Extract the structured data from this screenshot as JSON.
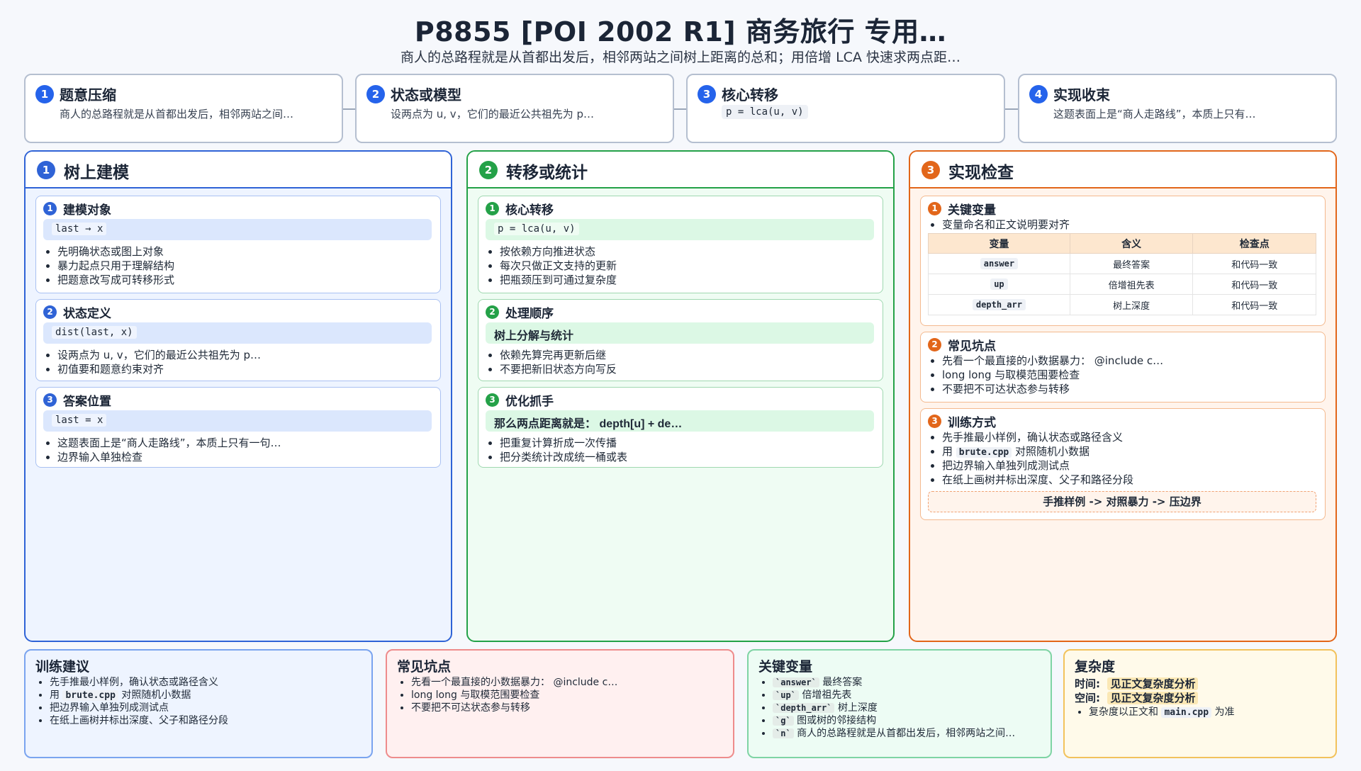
{
  "header": {
    "title": "P8855 [POI 2002 R1] 商务旅行 专用…",
    "subtitle": "商人的总路程就是从首都出发后，相邻两站之间树上距离的总和；用倍增 LCA 快速求两点距…"
  },
  "steps": [
    {
      "num": "1",
      "title": "题意压缩",
      "desc": "商人的总路程就是从首都出发后，相邻两站之间…"
    },
    {
      "num": "2",
      "title": "状态或模型",
      "desc": "设两点为 u, v，它们的最近公共祖先为 p…"
    },
    {
      "num": "3",
      "title": "核心转移",
      "code": "p = lca(u, v)"
    },
    {
      "num": "4",
      "title": "实现收束",
      "desc": "这题表面上是“商人走路线”，本质上只有…"
    }
  ],
  "columns": {
    "modeling": {
      "num": "1",
      "title": "树上建模",
      "cards": [
        {
          "num": "1",
          "title": "建模对象",
          "code": "last → x",
          "items": [
            "先明确状态或图上对象",
            "暴力起点只用于理解结构",
            "把题意改写成可转移形式"
          ]
        },
        {
          "num": "2",
          "title": "状态定义",
          "code": "dist(last, x)",
          "items": [
            "设两点为 u, v，它们的最近公共祖先为 p…",
            "初值要和题意约束对齐"
          ]
        },
        {
          "num": "3",
          "title": "答案位置",
          "code": "last = x",
          "items": [
            "这题表面上是“商人走路线”，本质上只有一句…",
            "边界输入单独检查"
          ]
        }
      ]
    },
    "transition": {
      "num": "2",
      "title": "转移或统计",
      "cards": [
        {
          "num": "1",
          "title": "核心转移",
          "code": "p = lca(u, v)",
          "items": [
            "按依赖方向推进状态",
            "每次只做正文支持的更新",
            "把瓶颈压到可通过复杂度"
          ]
        },
        {
          "num": "2",
          "title": "处理顺序",
          "code": "树上分解与统计",
          "items": [
            "依赖先算完再更新后继",
            "不要把新旧状态方向写反"
          ]
        },
        {
          "num": "3",
          "title": "优化抓手",
          "code": "那么两点距离就是： depth[u] + de…",
          "items": [
            "把重复计算折成一次传播",
            "把分类统计改成统一桶或表"
          ]
        }
      ]
    },
    "check": {
      "num": "3",
      "title": "实现检查",
      "vars": {
        "num": "1",
        "title": "关键变量",
        "note": "变量命名和正文说明要对齐",
        "headers": [
          "变量",
          "含义",
          "检查点"
        ],
        "rows": [
          [
            "answer",
            "最终答案",
            "和代码一致"
          ],
          [
            "up",
            "倍增祖先表",
            "和代码一致"
          ],
          [
            "depth_arr",
            "树上深度",
            "和代码一致"
          ]
        ]
      },
      "pitfalls": {
        "num": "2",
        "title": "常见坑点",
        "items": [
          "先看一个最直接的小数据暴力： @include c…",
          "long long 与取模范围要检查",
          "不要把不可达状态参与转移"
        ]
      },
      "training": {
        "num": "3",
        "title": "训练方式",
        "item1": "先手推最小样例，确认状态或路径含义",
        "item2_pre": "用",
        "item2_code": "brute.cpp",
        "item2_post": "对照随机小数据",
        "item3": "把边界输入单独列成测试点",
        "item4": "在纸上画树并标出深度、父子和路径分段",
        "flow": "手推样例 -> 对照暴力 -> 压边界"
      }
    }
  },
  "bottom": {
    "advice": {
      "title": "训练建议",
      "item1": "先手推最小样例，确认状态或路径含义",
      "item2_pre": "用",
      "item2_code": "brute.cpp",
      "item2_post": "对照随机小数据",
      "item3": "把边界输入单独列成测试点",
      "item4": "在纸上画树并标出深度、父子和路径分段"
    },
    "pitfalls": {
      "title": "常见坑点",
      "items": [
        "先看一个最直接的小数据暴力： @include c…",
        "long long 与取模范围要检查",
        "不要把不可达状态参与转移"
      ]
    },
    "vars": {
      "title": "关键变量",
      "rows": [
        {
          "code": "`answer`",
          "text": "最终答案"
        },
        {
          "code": "`up`",
          "text": "倍增祖先表"
        },
        {
          "code": "`depth_arr`",
          "text": "树上深度"
        },
        {
          "code": "`g`",
          "text": "图或树的邻接结构"
        },
        {
          "code": "`n`",
          "text": "商人的总路程就是从首都出发后，相邻两站之间…"
        }
      ]
    },
    "complexity": {
      "title": "复杂度",
      "time_label": "时间:",
      "time_value": "见正文复杂度分析",
      "space_label": "空间:",
      "space_value": "见正文复杂度分析",
      "note_pre": "复杂度以正文和",
      "note_code": "main.cpp",
      "note_post": "为准"
    }
  },
  "colors": {
    "blue": "#2f63d6",
    "green": "#24a148",
    "orange": "#e2661a"
  }
}
